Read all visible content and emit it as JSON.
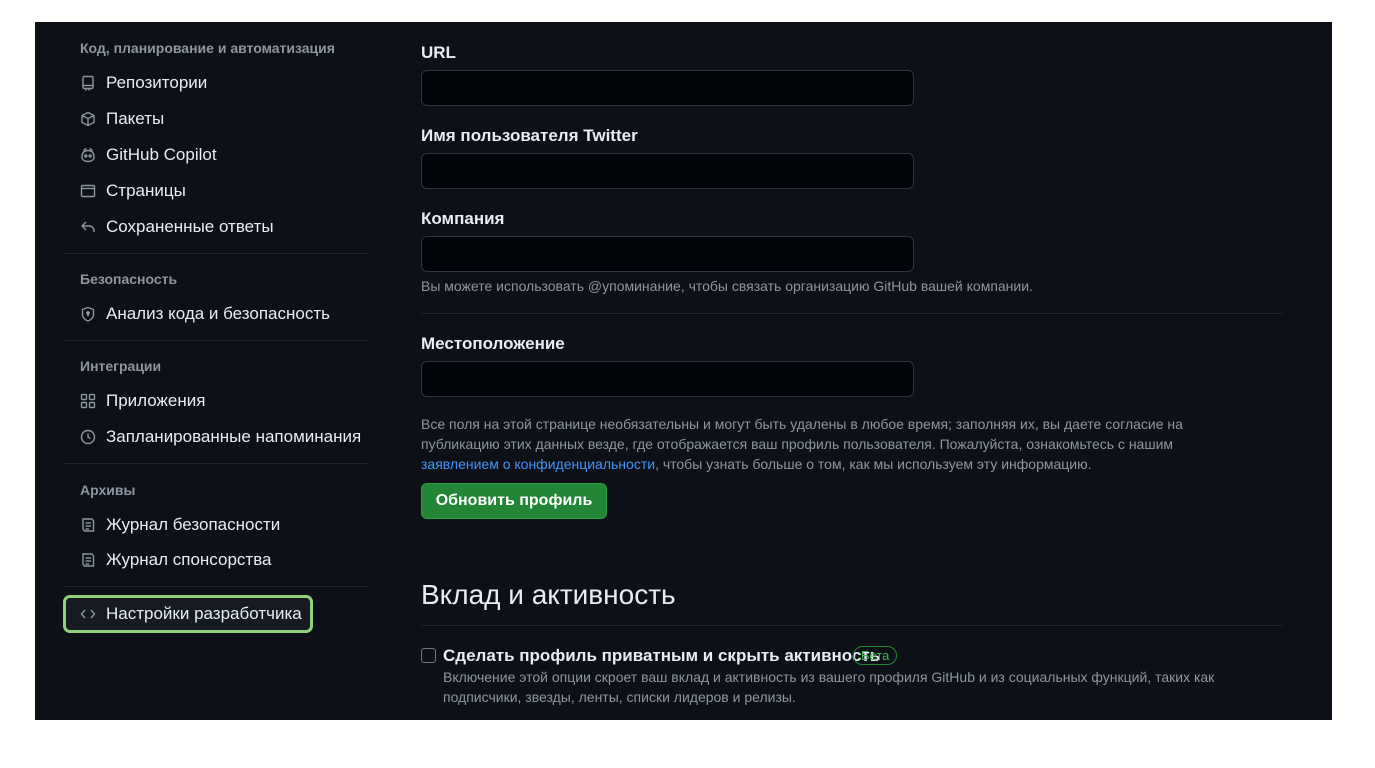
{
  "sidebar": {
    "sections": [
      {
        "title": "Код, планирование и автоматизация"
      },
      {
        "title": "Безопасность"
      },
      {
        "title": "Интеграции"
      },
      {
        "title": "Архивы"
      }
    ],
    "items": [
      {
        "label": "Репозитории",
        "icon": "repo-icon"
      },
      {
        "label": "Пакеты",
        "icon": "package-icon"
      },
      {
        "label": "GitHub Copilot",
        "icon": "copilot-icon"
      },
      {
        "label": "Страницы",
        "icon": "browser-icon"
      },
      {
        "label": "Сохраненные ответы",
        "icon": "reply-icon"
      },
      {
        "label": "Анализ кода и безопасность",
        "icon": "shield-icon"
      },
      {
        "label": "Приложения",
        "icon": "apps-icon"
      },
      {
        "label": "Запланированные напоминания",
        "icon": "clock-icon"
      },
      {
        "label": "Журнал безопасности",
        "icon": "log-icon"
      },
      {
        "label": "Журнал спонсорства",
        "icon": "log-icon"
      },
      {
        "label": "Настройки разработчика",
        "icon": "code-icon",
        "active": true
      }
    ]
  },
  "form": {
    "url_label": "URL",
    "url_value": "",
    "twitter_label": "Имя пользователя Twitter",
    "twitter_value": "",
    "company_label": "Компания",
    "company_value": "",
    "company_note": "Вы можете использовать @упоминание, чтобы связать организацию GitHub вашей компании.",
    "location_label": "Местоположение",
    "location_value": "",
    "privacy_note_line1": "Все поля на этой странице необязательны и могут быть удалены в любое время; заполняя их, вы даете согласие на",
    "privacy_note_line2": "публикацию этих данных везде, где отображается ваш профиль пользователя. Пожалуйста, ознакомьтесь с нашим",
    "privacy_link": "заявлением о конфиденциальности",
    "privacy_note_line3": ", чтобы узнать больше о том, как мы используем эту информацию.",
    "update_button": "Обновить профиль"
  },
  "activity": {
    "heading": "Вклад и активность",
    "private_label": "Сделать профиль приватным и скрыть активность",
    "private_checked": false,
    "beta_badge": "Бета",
    "description_line1": "Включение этой опции скроет ваш вклад и активность из вашего профиля GitHub и из социальных функций, таких как",
    "description_line2": "подписчики, звезды, ленты, списки лидеров и релизы."
  },
  "colors": {
    "background": "#0d1117",
    "text": "#e6edf3",
    "muted": "#8d96a0",
    "link": "#4493f8",
    "primary_button": "#238636",
    "active_outline": "#8fd17a"
  }
}
